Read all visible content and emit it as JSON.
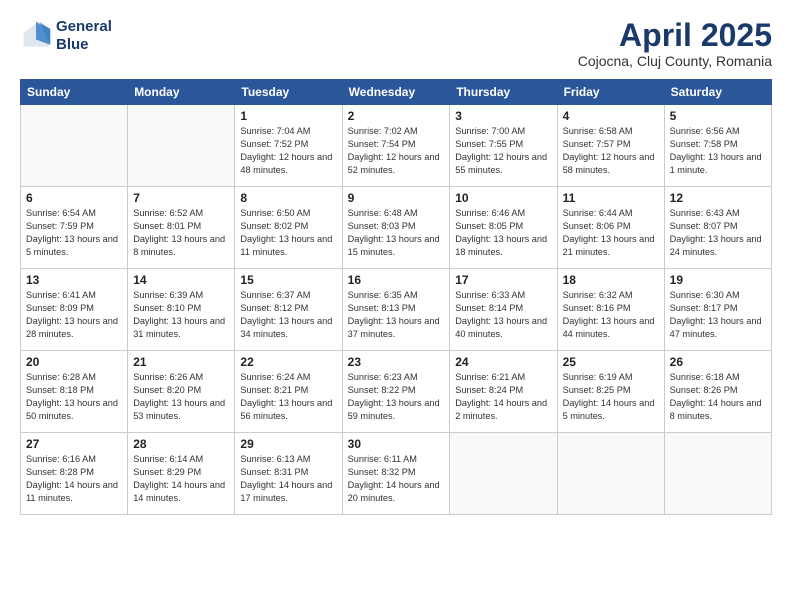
{
  "logo": {
    "line1": "General",
    "line2": "Blue"
  },
  "title": "April 2025",
  "subtitle": "Cojocna, Cluj County, Romania",
  "weekdays": [
    "Sunday",
    "Monday",
    "Tuesday",
    "Wednesday",
    "Thursday",
    "Friday",
    "Saturday"
  ],
  "weeks": [
    [
      {
        "day": "",
        "sunrise": "",
        "sunset": "",
        "daylight": ""
      },
      {
        "day": "",
        "sunrise": "",
        "sunset": "",
        "daylight": ""
      },
      {
        "day": "1",
        "sunrise": "Sunrise: 7:04 AM",
        "sunset": "Sunset: 7:52 PM",
        "daylight": "Daylight: 12 hours and 48 minutes."
      },
      {
        "day": "2",
        "sunrise": "Sunrise: 7:02 AM",
        "sunset": "Sunset: 7:54 PM",
        "daylight": "Daylight: 12 hours and 52 minutes."
      },
      {
        "day": "3",
        "sunrise": "Sunrise: 7:00 AM",
        "sunset": "Sunset: 7:55 PM",
        "daylight": "Daylight: 12 hours and 55 minutes."
      },
      {
        "day": "4",
        "sunrise": "Sunrise: 6:58 AM",
        "sunset": "Sunset: 7:57 PM",
        "daylight": "Daylight: 12 hours and 58 minutes."
      },
      {
        "day": "5",
        "sunrise": "Sunrise: 6:56 AM",
        "sunset": "Sunset: 7:58 PM",
        "daylight": "Daylight: 13 hours and 1 minute."
      }
    ],
    [
      {
        "day": "6",
        "sunrise": "Sunrise: 6:54 AM",
        "sunset": "Sunset: 7:59 PM",
        "daylight": "Daylight: 13 hours and 5 minutes."
      },
      {
        "day": "7",
        "sunrise": "Sunrise: 6:52 AM",
        "sunset": "Sunset: 8:01 PM",
        "daylight": "Daylight: 13 hours and 8 minutes."
      },
      {
        "day": "8",
        "sunrise": "Sunrise: 6:50 AM",
        "sunset": "Sunset: 8:02 PM",
        "daylight": "Daylight: 13 hours and 11 minutes."
      },
      {
        "day": "9",
        "sunrise": "Sunrise: 6:48 AM",
        "sunset": "Sunset: 8:03 PM",
        "daylight": "Daylight: 13 hours and 15 minutes."
      },
      {
        "day": "10",
        "sunrise": "Sunrise: 6:46 AM",
        "sunset": "Sunset: 8:05 PM",
        "daylight": "Daylight: 13 hours and 18 minutes."
      },
      {
        "day": "11",
        "sunrise": "Sunrise: 6:44 AM",
        "sunset": "Sunset: 8:06 PM",
        "daylight": "Daylight: 13 hours and 21 minutes."
      },
      {
        "day": "12",
        "sunrise": "Sunrise: 6:43 AM",
        "sunset": "Sunset: 8:07 PM",
        "daylight": "Daylight: 13 hours and 24 minutes."
      }
    ],
    [
      {
        "day": "13",
        "sunrise": "Sunrise: 6:41 AM",
        "sunset": "Sunset: 8:09 PM",
        "daylight": "Daylight: 13 hours and 28 minutes."
      },
      {
        "day": "14",
        "sunrise": "Sunrise: 6:39 AM",
        "sunset": "Sunset: 8:10 PM",
        "daylight": "Daylight: 13 hours and 31 minutes."
      },
      {
        "day": "15",
        "sunrise": "Sunrise: 6:37 AM",
        "sunset": "Sunset: 8:12 PM",
        "daylight": "Daylight: 13 hours and 34 minutes."
      },
      {
        "day": "16",
        "sunrise": "Sunrise: 6:35 AM",
        "sunset": "Sunset: 8:13 PM",
        "daylight": "Daylight: 13 hours and 37 minutes."
      },
      {
        "day": "17",
        "sunrise": "Sunrise: 6:33 AM",
        "sunset": "Sunset: 8:14 PM",
        "daylight": "Daylight: 13 hours and 40 minutes."
      },
      {
        "day": "18",
        "sunrise": "Sunrise: 6:32 AM",
        "sunset": "Sunset: 8:16 PM",
        "daylight": "Daylight: 13 hours and 44 minutes."
      },
      {
        "day": "19",
        "sunrise": "Sunrise: 6:30 AM",
        "sunset": "Sunset: 8:17 PM",
        "daylight": "Daylight: 13 hours and 47 minutes."
      }
    ],
    [
      {
        "day": "20",
        "sunrise": "Sunrise: 6:28 AM",
        "sunset": "Sunset: 8:18 PM",
        "daylight": "Daylight: 13 hours and 50 minutes."
      },
      {
        "day": "21",
        "sunrise": "Sunrise: 6:26 AM",
        "sunset": "Sunset: 8:20 PM",
        "daylight": "Daylight: 13 hours and 53 minutes."
      },
      {
        "day": "22",
        "sunrise": "Sunrise: 6:24 AM",
        "sunset": "Sunset: 8:21 PM",
        "daylight": "Daylight: 13 hours and 56 minutes."
      },
      {
        "day": "23",
        "sunrise": "Sunrise: 6:23 AM",
        "sunset": "Sunset: 8:22 PM",
        "daylight": "Daylight: 13 hours and 59 minutes."
      },
      {
        "day": "24",
        "sunrise": "Sunrise: 6:21 AM",
        "sunset": "Sunset: 8:24 PM",
        "daylight": "Daylight: 14 hours and 2 minutes."
      },
      {
        "day": "25",
        "sunrise": "Sunrise: 6:19 AM",
        "sunset": "Sunset: 8:25 PM",
        "daylight": "Daylight: 14 hours and 5 minutes."
      },
      {
        "day": "26",
        "sunrise": "Sunrise: 6:18 AM",
        "sunset": "Sunset: 8:26 PM",
        "daylight": "Daylight: 14 hours and 8 minutes."
      }
    ],
    [
      {
        "day": "27",
        "sunrise": "Sunrise: 6:16 AM",
        "sunset": "Sunset: 8:28 PM",
        "daylight": "Daylight: 14 hours and 11 minutes."
      },
      {
        "day": "28",
        "sunrise": "Sunrise: 6:14 AM",
        "sunset": "Sunset: 8:29 PM",
        "daylight": "Daylight: 14 hours and 14 minutes."
      },
      {
        "day": "29",
        "sunrise": "Sunrise: 6:13 AM",
        "sunset": "Sunset: 8:31 PM",
        "daylight": "Daylight: 14 hours and 17 minutes."
      },
      {
        "day": "30",
        "sunrise": "Sunrise: 6:11 AM",
        "sunset": "Sunset: 8:32 PM",
        "daylight": "Daylight: 14 hours and 20 minutes."
      },
      {
        "day": "",
        "sunrise": "",
        "sunset": "",
        "daylight": ""
      },
      {
        "day": "",
        "sunrise": "",
        "sunset": "",
        "daylight": ""
      },
      {
        "day": "",
        "sunrise": "",
        "sunset": "",
        "daylight": ""
      }
    ]
  ]
}
